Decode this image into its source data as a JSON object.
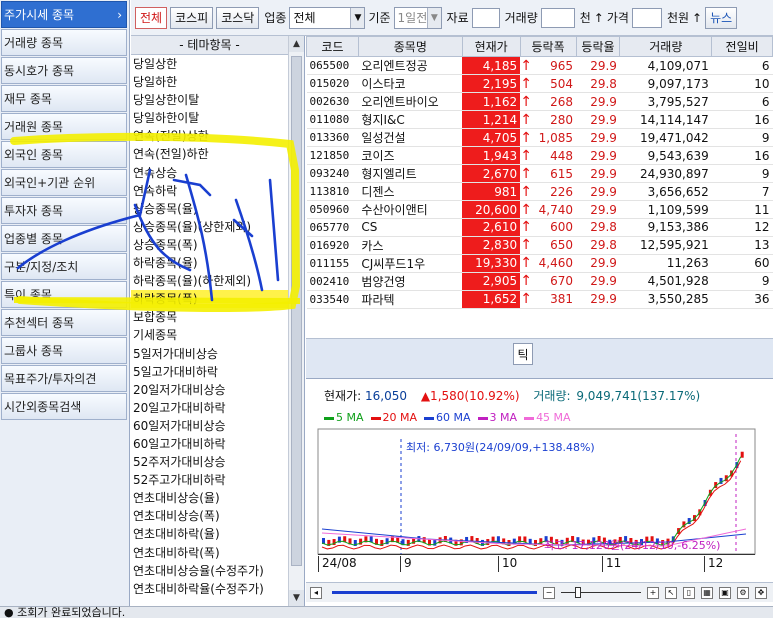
{
  "nav": {
    "items": [
      {
        "label": "주가시세 종목",
        "active": true
      },
      {
        "label": "거래량 종목"
      },
      {
        "label": "동시호가 종목"
      },
      {
        "label": "재무 종목"
      },
      {
        "label": "거래원 종목"
      },
      {
        "label": "외국인 종목"
      },
      {
        "label": "외국인+기관 순위"
      },
      {
        "label": "투자자 종목"
      },
      {
        "label": "업종별 종목"
      },
      {
        "label": "구분/지정/조치"
      },
      {
        "label": "특이 종목"
      },
      {
        "label": "추천섹터 종목"
      },
      {
        "label": "그룹사 종목"
      },
      {
        "label": "목표주가/투자의견"
      },
      {
        "label": "시간외종목검색"
      }
    ],
    "active_arrow": "›"
  },
  "toolbar": {
    "market_buttons": [
      "전체",
      "코스피",
      "코스닥"
    ],
    "sector_label": "업종",
    "sector_value": "전체",
    "basis_label": "기준",
    "basis_value": "1일전",
    "capital_label": "자료",
    "volume_label": "거래량",
    "volume_unit": "천",
    "price_label": "가격",
    "price_unit": "천원",
    "news_button": "뉴스"
  },
  "theme_list": {
    "header": "- 테마항목 -",
    "items": [
      "당일상한",
      "당일하한",
      "당일상한이탈",
      "당일하한이탈",
      "연속(전일)상한",
      "연속(전일)하한",
      "연속상승",
      "연속하락",
      "상승종목(율)",
      "상승종목(율)(상한제외)",
      "상승종목(폭)",
      "하락종목(율)",
      "하락종목(율)(하한제외)",
      "하락종목(폭)",
      "보합종목",
      "기세종목",
      "5일저가대비상승",
      "5일고가대비하락",
      "20일저가대비상승",
      "20일고가대비하락",
      "60일저가대비상승",
      "60일고가대비하락",
      "52주저가대비상승",
      "52주고가대비하락",
      "연초대비상승(율)",
      "연초대비상승(폭)",
      "연초대비하락(율)",
      "연초대비하락(폭)",
      "연초대비상승율(수정주가)",
      "연초대비하락율(수정주가)"
    ],
    "selected_index": 13
  },
  "stock_table": {
    "columns": [
      "코드",
      "종목명",
      "현재가",
      "등락폭",
      "등락율",
      "거래량",
      "전일비"
    ],
    "rows": [
      {
        "code": "065500",
        "name": "오리엔트정공",
        "price": "4,185",
        "change": "965",
        "rate": "29.9",
        "volume": "4,109,071",
        "prev": "6"
      },
      {
        "code": "015020",
        "name": "이스타코",
        "price": "2,195",
        "change": "504",
        "rate": "29.8",
        "volume": "9,097,173",
        "prev": "10"
      },
      {
        "code": "002630",
        "name": "오리엔트바이오",
        "price": "1,162",
        "change": "268",
        "rate": "29.9",
        "volume": "3,795,527",
        "prev": "6"
      },
      {
        "code": "011080",
        "name": "형지I&C",
        "price": "1,214",
        "change": "280",
        "rate": "29.9",
        "volume": "14,114,147",
        "prev": "16"
      },
      {
        "code": "013360",
        "name": "일성건설",
        "price": "4,705",
        "change": "1,085",
        "rate": "29.9",
        "volume": "19,471,042",
        "prev": "9"
      },
      {
        "code": "121850",
        "name": "코이즈",
        "price": "1,943",
        "change": "448",
        "rate": "29.9",
        "volume": "9,543,639",
        "prev": "16"
      },
      {
        "code": "093240",
        "name": "형지엘리트",
        "price": "2,670",
        "change": "615",
        "rate": "29.9",
        "volume": "24,930,897",
        "prev": "9"
      },
      {
        "code": "113810",
        "name": "디젠스",
        "price": "981",
        "change": "226",
        "rate": "29.9",
        "volume": "3,656,652",
        "prev": "7"
      },
      {
        "code": "050960",
        "name": "수산아이앤티",
        "price": "20,600",
        "change": "4,740",
        "rate": "29.9",
        "volume": "1,109,599",
        "prev": "11"
      },
      {
        "code": "065770",
        "name": "CS",
        "price": "2,610",
        "change": "600",
        "rate": "29.8",
        "volume": "9,153,386",
        "prev": "12"
      },
      {
        "code": "016920",
        "name": "카스",
        "price": "2,830",
        "change": "650",
        "rate": "29.8",
        "volume": "12,595,921",
        "prev": "13"
      },
      {
        "code": "011155",
        "name": "CJ씨푸드1우",
        "price": "19,330",
        "change": "4,460",
        "rate": "29.9",
        "volume": "11,263",
        "prev": "60"
      },
      {
        "code": "002410",
        "name": "범양건영",
        "price": "2,905",
        "change": "670",
        "rate": "29.9",
        "volume": "4,501,928",
        "prev": "9"
      },
      {
        "code": "033540",
        "name": "파라텍",
        "price": "1,652",
        "change": "381",
        "rate": "29.9",
        "volume": "3,550,285",
        "prev": "36"
      }
    ],
    "up_arrow": "↑"
  },
  "tick_button": "틱",
  "chart": {
    "current_label": "현재가:",
    "current_value": "16,050",
    "change_text": "▲1,580(10.92%)",
    "volume_label": "거래량:",
    "volume_value": "9,049,741(137.17%)",
    "ma_legend": [
      {
        "label": "5 MA",
        "color": "#0fa01a"
      },
      {
        "label": "20 MA",
        "color": "#e31010"
      },
      {
        "label": "60 MA",
        "color": "#1a3fd0"
      },
      {
        "label": "3 MA",
        "color": "#c020c0"
      },
      {
        "label": "45 MA",
        "color": "#f06ad8"
      }
    ],
    "low_annotation": "최저: 6,730원(24/09/09,+138.48%)",
    "high_annotation": "최고: 17,120원(24/12/10,-6.25%)",
    "date_labels": [
      "24/08",
      "9",
      "10",
      "11",
      "12"
    ]
  },
  "status": {
    "text": "조회가 완료되었습니다."
  },
  "colors": {
    "accent": "#2f6fd1",
    "price_bg": "#ee1c1c",
    "highlight": "#fff24a",
    "annotation_yellow": "#f4f000",
    "annotation_blue": "#1a3fd0"
  }
}
